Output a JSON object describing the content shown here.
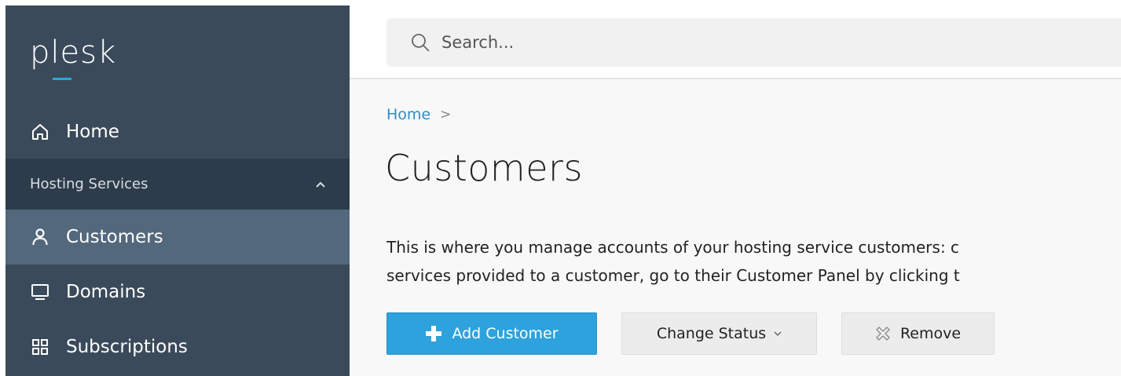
{
  "sidebar": {
    "logo": "plesk",
    "home_label": "Home",
    "section_label": "Hosting Services",
    "items": [
      {
        "label": "Customers",
        "icon": "user-icon"
      },
      {
        "label": "Domains",
        "icon": "monitor-icon"
      },
      {
        "label": "Subscriptions",
        "icon": "grid-icon"
      }
    ]
  },
  "search": {
    "placeholder": "Search..."
  },
  "breadcrumb": {
    "home": "Home",
    "separator": ">"
  },
  "page": {
    "title": "Customers",
    "description_line1": "This is where you manage accounts of your hosting service customers: c",
    "description_line2": "services provided to a customer, go to their Customer Panel by clicking t"
  },
  "toolbar": {
    "add_label": "Add Customer",
    "status_label": "Change Status",
    "remove_label": "Remove"
  },
  "colors": {
    "sidebar_bg": "#3a4a5a",
    "sidebar_active": "#53687c",
    "accent": "#2ea2dc",
    "link": "#2b8ec4"
  }
}
